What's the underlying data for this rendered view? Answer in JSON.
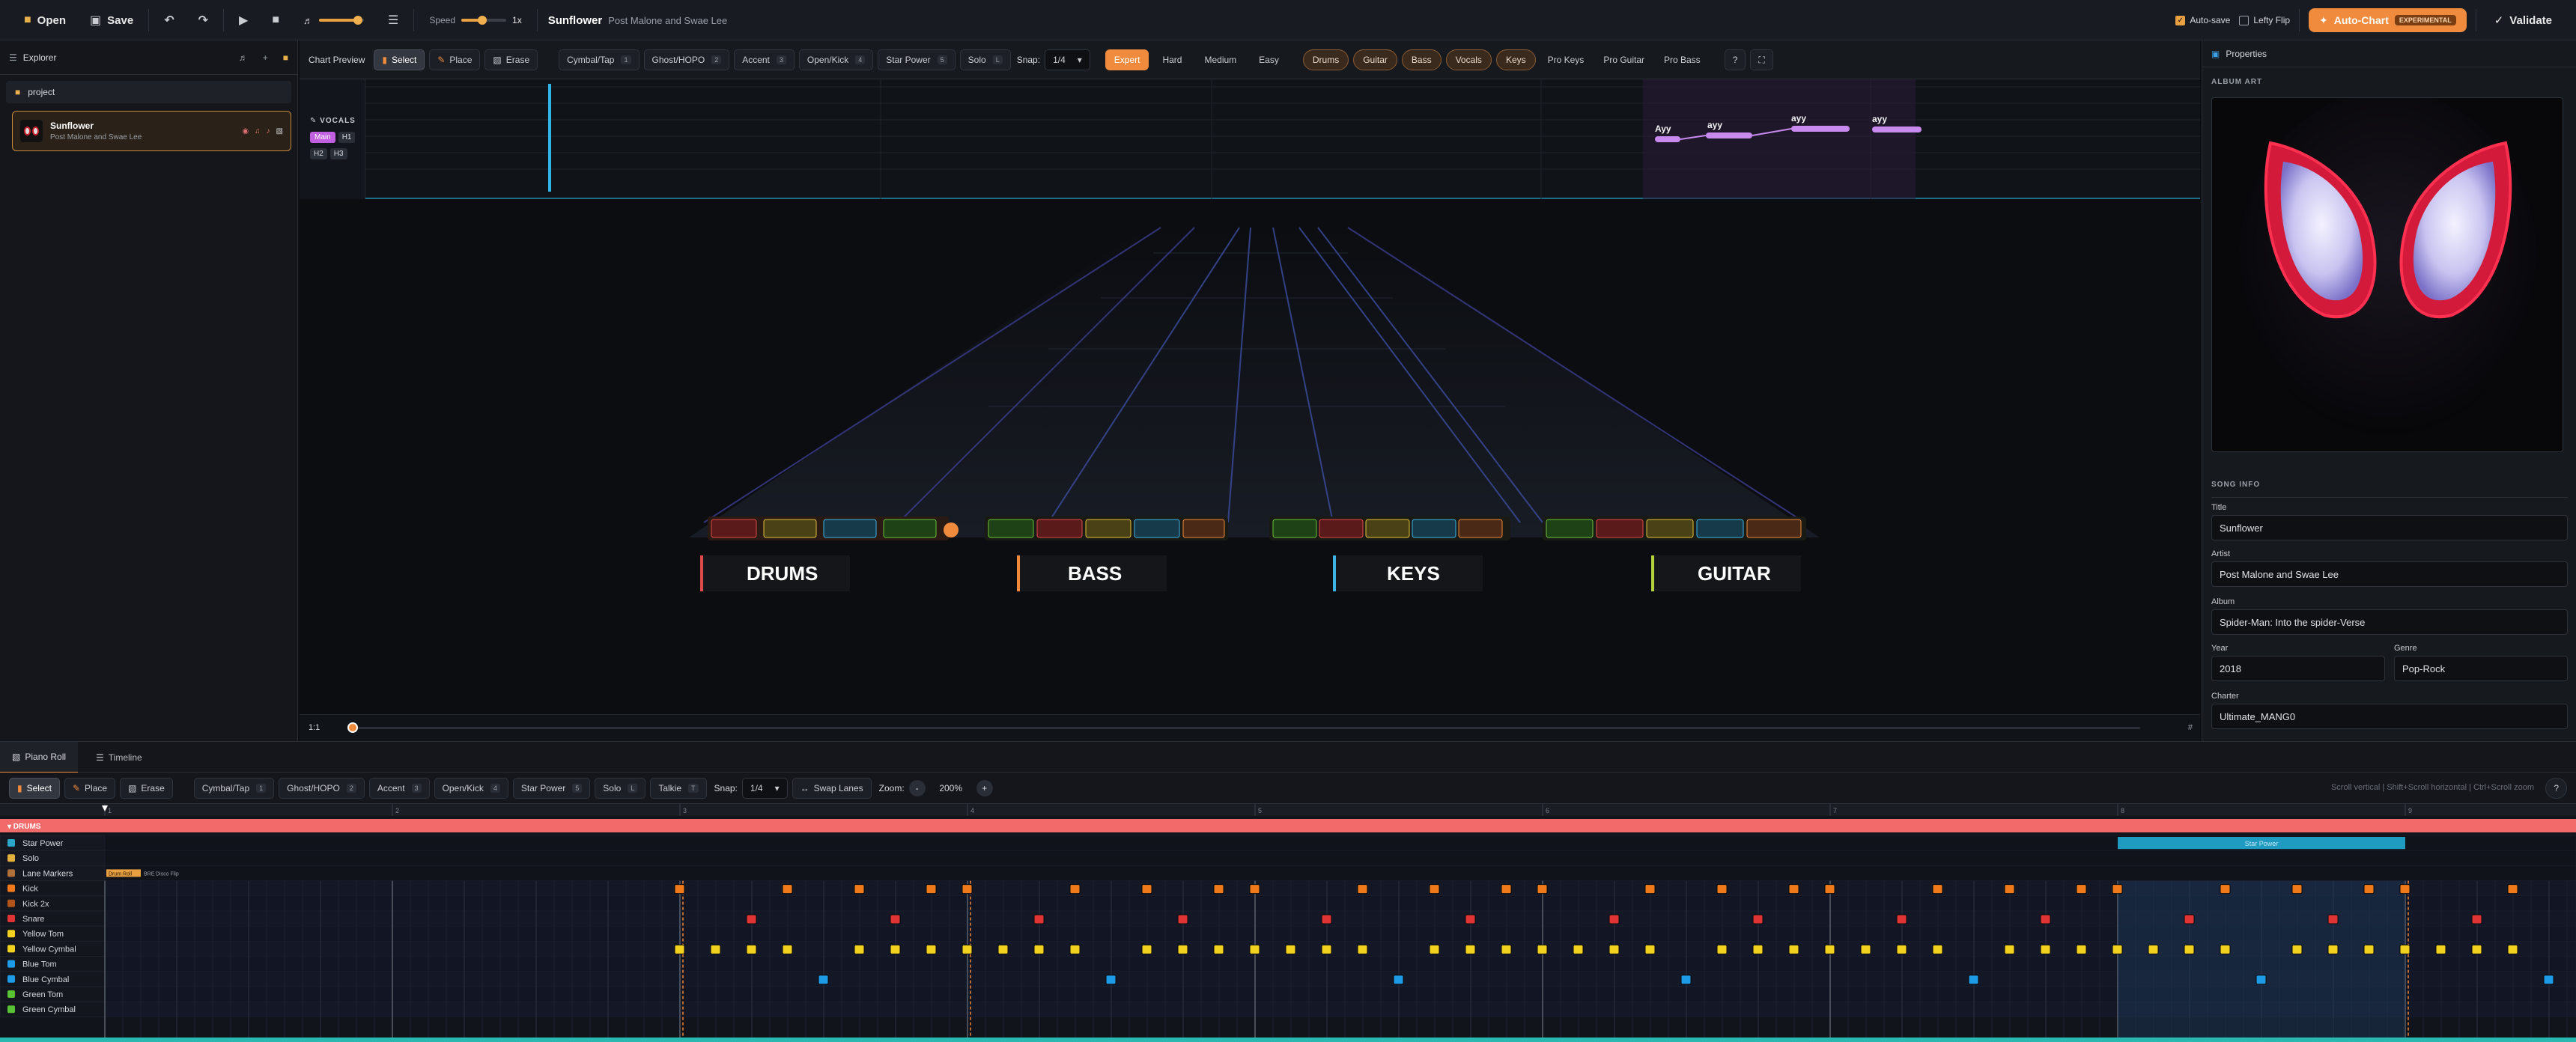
{
  "topbar": {
    "open_label": "Open",
    "save_label": "Save",
    "speed_label": "Speed",
    "speed_value": "1x",
    "song_title": "Sunflower",
    "song_artist": "Post Malone and Swae Lee",
    "autosave_label": "Auto-save",
    "lefty_label": "Lefty Flip",
    "autochart_label": "Auto-Chart",
    "autochart_badge": "EXPERIMENTAL",
    "validate_label": "Validate"
  },
  "explorer": {
    "title": "Explorer",
    "folder": "project",
    "song_name": "Sunflower",
    "song_artist": "Post Malone and Swae Lee"
  },
  "chart_toolbar": {
    "preview_label": "Chart Preview",
    "select": "Select",
    "place": "Place",
    "erase": "Erase",
    "cymbal": "Cymbal/Tap",
    "ghost": "Ghost/HOPO",
    "accent": "Accent",
    "openkick": "Open/Kick",
    "starpower": "Star Power",
    "solo": "Solo",
    "k1": "1",
    "k2": "2",
    "k3": "3",
    "k4": "4",
    "k5": "5",
    "snap_label": "Snap:",
    "snap_value": "1/4",
    "diffs": [
      "Expert",
      "Hard",
      "Medium",
      "Easy"
    ],
    "instruments": [
      "Drums",
      "Guitar",
      "Bass",
      "Vocals",
      "Keys"
    ],
    "pro": [
      "Pro Keys",
      "Pro Guitar",
      "Pro Bass"
    ],
    "help": "?"
  },
  "vocals": {
    "label": "VOCALS",
    "parts": [
      "Main",
      "H1",
      "H2",
      "H3"
    ],
    "lyrics": [
      "Ayy",
      "ayy",
      "ayy",
      "ayy"
    ]
  },
  "highway": {
    "labels": [
      "DRUMS",
      "BASS",
      "KEYS",
      "GUITAR"
    ],
    "colors": [
      "#e04a4a",
      "#f08a3c",
      "#3cb4e6",
      "#b4d23c"
    ],
    "time": "1:1",
    "end_marker": "#"
  },
  "properties": {
    "title": "Properties",
    "album_art_label": "ALBUM ART",
    "song_info_label": "SONG INFO",
    "title_label": "Title",
    "title_value": "Sunflower",
    "artist_label": "Artist",
    "artist_value": "Post Malone and Swae Lee",
    "album_label": "Album",
    "album_value": "Spider-Man: Into the spider-Verse",
    "year_label": "Year",
    "year_value": "2018",
    "genre_label": "Genre",
    "genre_value": "Pop-Rock",
    "charter_label": "Charter",
    "charter_value": "Ultimate_MANG0"
  },
  "bottom": {
    "tab_pianoroll": "Piano Roll",
    "tab_timeline": "Timeline",
    "select": "Select",
    "place": "Place",
    "erase": "Erase",
    "cymbal": "Cymbal/Tap",
    "ghost": "Ghost/HOPO",
    "accent": "Accent",
    "openkick": "Open/Kick",
    "starpower": "Star Power",
    "solo": "Solo",
    "talkie": "Talkie",
    "snap_label": "Snap:",
    "snap_value": "1/4",
    "swap": "Swap Lanes",
    "zoom_label": "Zoom:",
    "zoom_value": "200%",
    "hint": "Scroll vertical | Shift+Scroll horizontal | Ctrl+Scroll zoom",
    "help": "?",
    "drums_header": "DRUMS",
    "starpower_section": "Star Power",
    "drum_roll_tag": "Drum Roll",
    "drum_tags": [
      "BRE",
      "Disco Flip"
    ],
    "measures": [
      "1",
      "2",
      "3",
      "4",
      "5",
      "6",
      "7",
      "8",
      "9"
    ],
    "lanes": [
      {
        "name": "Star Power",
        "color": "#2aa7c9"
      },
      {
        "name": "Solo",
        "color": "#e0b13c"
      },
      {
        "name": "Lane Markers",
        "color": "#b0703a"
      },
      {
        "name": "Kick",
        "color": "#f07a1a"
      },
      {
        "name": "Kick 2x",
        "color": "#b0541a"
      },
      {
        "name": "Snare",
        "color": "#e03434"
      },
      {
        "name": "Yellow Tom",
        "color": "#f2d21e"
      },
      {
        "name": "Yellow Cymbal",
        "color": "#f2d21e"
      },
      {
        "name": "Blue Tom",
        "color": "#1e9be6"
      },
      {
        "name": "Blue Cymbal",
        "color": "#1e9be6"
      },
      {
        "name": "Green Tom",
        "color": "#58c234"
      },
      {
        "name": "Green Cymbal",
        "color": "#58c234"
      }
    ]
  }
}
